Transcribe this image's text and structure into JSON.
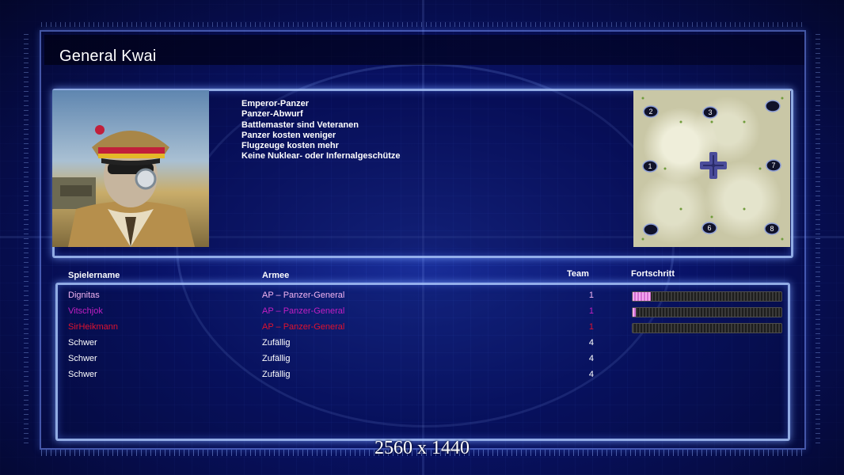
{
  "screen": {
    "title": "General Kwai",
    "watermark": "2560 x 1440"
  },
  "general": {
    "traits": [
      "Emperor-Panzer",
      "Panzer-Abwurf",
      "Battlemaster sind Veteranen",
      "Panzer kosten weniger",
      "Flugzeuge kosten mehr",
      "Keine Nuklear- oder Infernalgeschütze"
    ]
  },
  "minimap": {
    "start_positions": [
      "2",
      "3",
      "",
      "1",
      "7",
      "",
      "6",
      "8"
    ]
  },
  "player_table": {
    "headers": {
      "name": "Spielername",
      "army": "Armee",
      "team": "Team",
      "progress": "Fortschritt"
    },
    "rows": [
      {
        "name": "Dignitas",
        "army": "AP – Panzer-General",
        "team": "1",
        "progress": 0.12,
        "color": "#f2b4f2",
        "has_progress": true
      },
      {
        "name": "Vitschjok",
        "army": "AP – Panzer-General",
        "team": "1",
        "progress": 0.02,
        "color": "#c21fc2",
        "has_progress": true
      },
      {
        "name": "SirHeikmann",
        "army": "AP – Panzer-General",
        "team": "1",
        "progress": 0.0,
        "color": "#e0122e",
        "has_progress": true
      },
      {
        "name": "Schwer",
        "army": "Zufällig",
        "team": "4",
        "color": "#ffffff",
        "has_progress": false
      },
      {
        "name": "Schwer",
        "army": "Zufällig",
        "team": "4",
        "color": "#ffffff",
        "has_progress": false
      },
      {
        "name": "Schwer",
        "army": "Zufällig",
        "team": "4",
        "color": "#ffffff",
        "has_progress": false
      }
    ]
  }
}
